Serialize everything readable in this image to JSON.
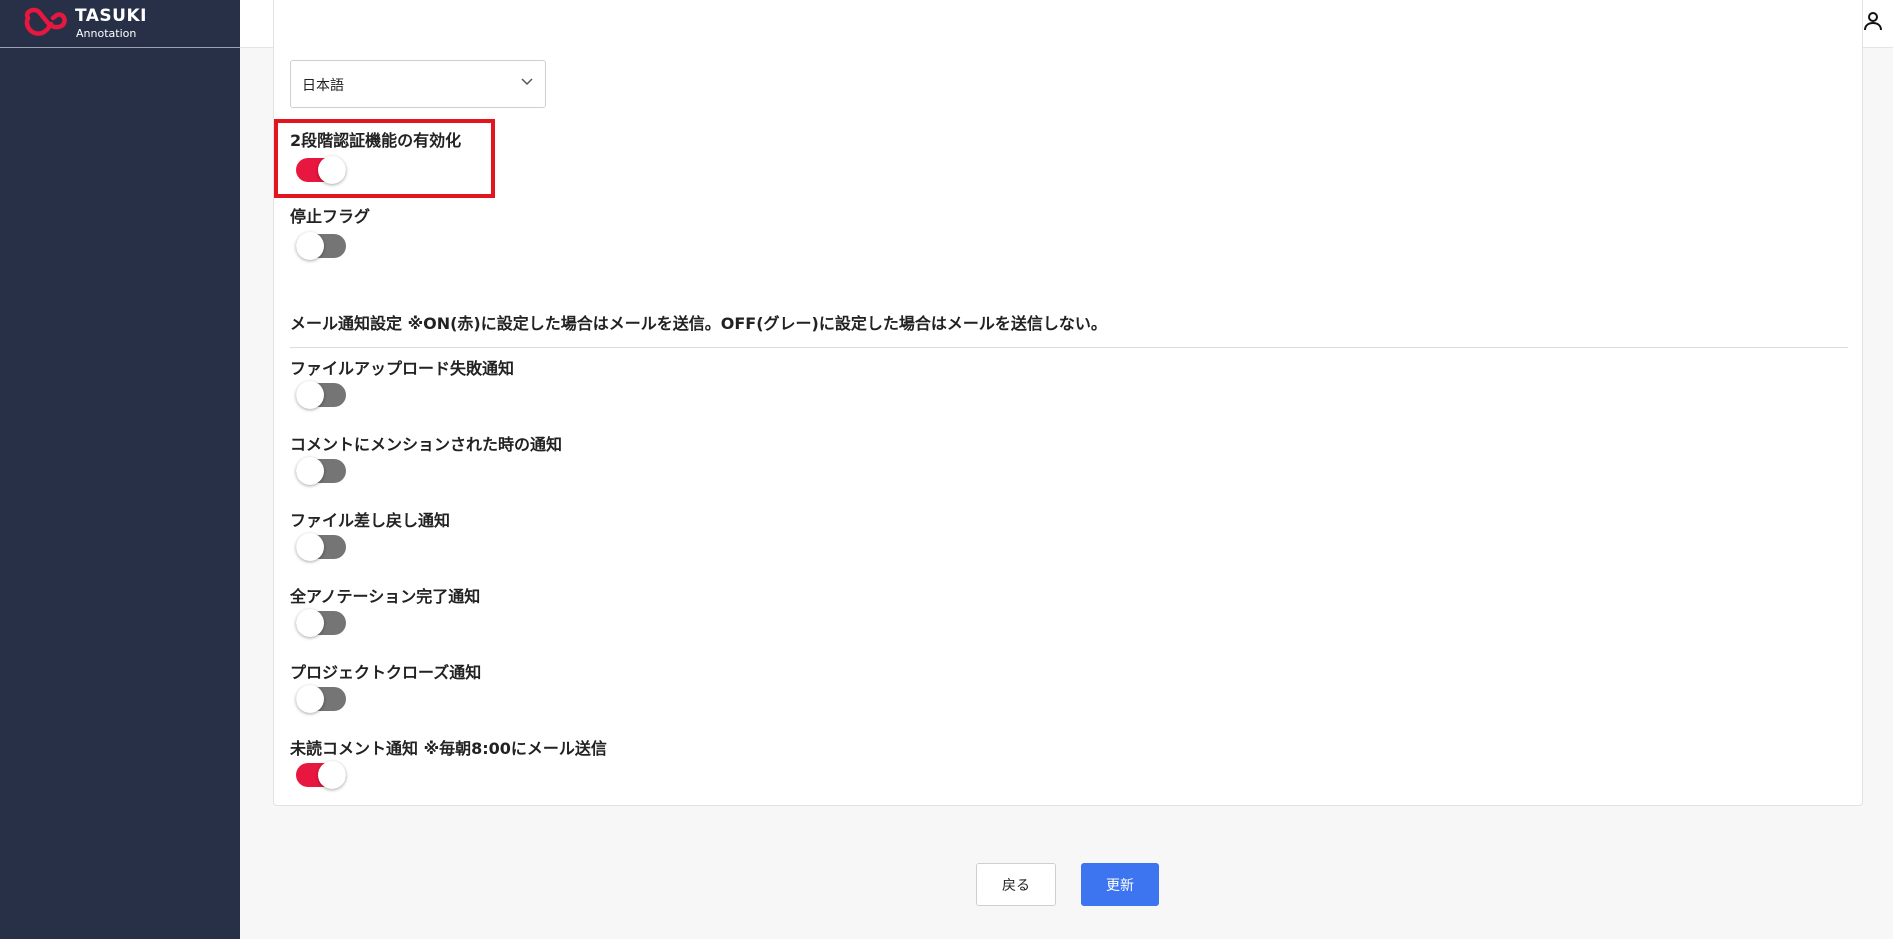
{
  "brand": {
    "name": "TASUKI",
    "sub": "Annotation",
    "logo_color": "#e8173f"
  },
  "header": {
    "icons": [
      "book-icon",
      "user-icon"
    ]
  },
  "settings": {
    "language": {
      "value": "日本語"
    },
    "two_factor": {
      "label": "2段階認証機能の有効化",
      "on": true
    },
    "suspend_flag": {
      "label": "停止フラグ",
      "on": false
    },
    "mail_section_title": "メール通知設定 ※ON(赤)に設定した場合はメールを送信。OFF(グレー)に設定した場合はメールを送信しない。",
    "notifications": [
      {
        "label": "ファイルアップロード失敗通知",
        "on": false
      },
      {
        "label": "コメントにメンションされた時の通知",
        "on": false
      },
      {
        "label": "ファイル差し戻し通知",
        "on": false
      },
      {
        "label": "全アノテーション完了通知",
        "on": false
      },
      {
        "label": "プロジェクトクローズ通知",
        "on": false
      },
      {
        "label": "未読コメント通知 ※毎朝8:00にメール送信",
        "on": true
      }
    ]
  },
  "buttons": {
    "back": "戻る",
    "update": "更新"
  },
  "colors": {
    "toggle_on": "#e8173f",
    "toggle_off": "#757575",
    "primary": "#3d74f0",
    "sidebar": "#283047",
    "highlight": "#e3161f"
  }
}
